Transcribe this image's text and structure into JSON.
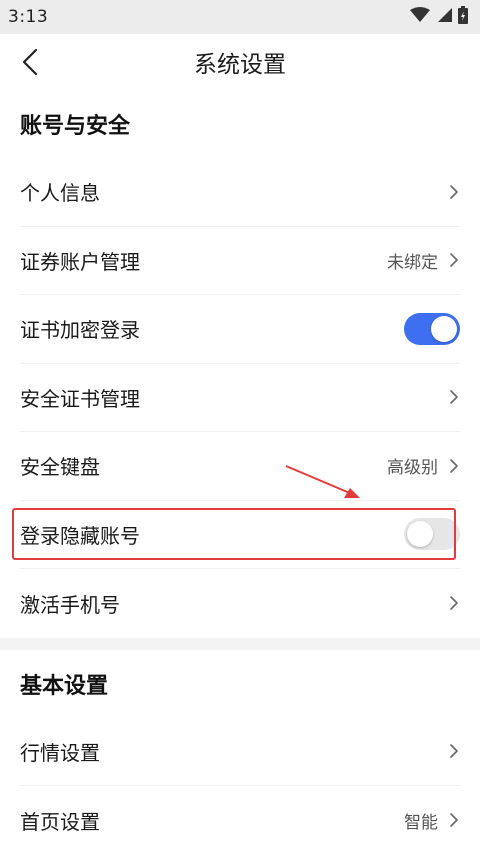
{
  "status_bar": {
    "time": "3:13"
  },
  "nav": {
    "title": "系统设置"
  },
  "sections": {
    "account": {
      "title": "账号与安全",
      "items": {
        "personal_info": {
          "label": "个人信息"
        },
        "securities_account": {
          "label": "证券账户管理",
          "value": "未绑定"
        },
        "cert_encrypt_login": {
          "label": "证书加密登录",
          "toggle": "on"
        },
        "security_cert": {
          "label": "安全证书管理"
        },
        "security_keyboard": {
          "label": "安全键盘",
          "value": "高级别"
        },
        "hide_account": {
          "label": "登录隐藏账号",
          "toggle": "off"
        },
        "activate_phone": {
          "label": "激活手机号"
        }
      }
    },
    "basic": {
      "title": "基本设置",
      "items": {
        "market_settings": {
          "label": "行情设置"
        },
        "home_settings": {
          "label": "首页设置",
          "value": "智能"
        }
      }
    }
  },
  "colors": {
    "toggle_on": "#3e6ff0",
    "toggle_off": "#e6e6e6",
    "annotation": "#e23b3b"
  }
}
